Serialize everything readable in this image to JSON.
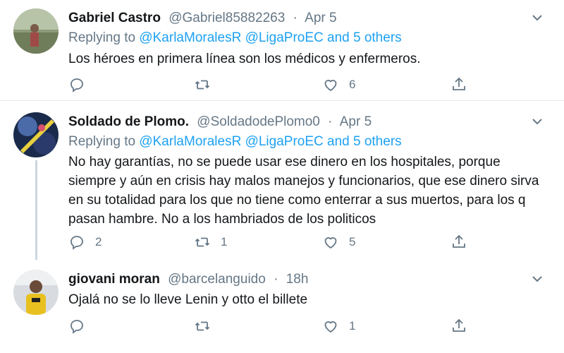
{
  "tweets": [
    {
      "name": "Gabriel Castro",
      "handle": "@Gabriel85882263",
      "dot": "·",
      "time": "Apr 5",
      "replying_prefix": "Replying to",
      "replying_mentions": "@KarlaMoralesR @LigaProEC and 5 others",
      "text": "Los héroes en primera línea son los médicos y enfermeros.",
      "reply_count": "",
      "retweet_count": "",
      "like_count": "6"
    },
    {
      "name": "Soldado de Plomo.",
      "handle": "@SoldadodePlomo0",
      "dot": "·",
      "time": "Apr 5",
      "replying_prefix": "Replying to",
      "replying_mentions": "@KarlaMoralesR @LigaProEC and 5 others",
      "text": "No hay garantías, no se puede usar ese dinero en los hospitales, porque siempre y aún en crisis hay malos manejos y funcionarios, que ese dinero sirva en su totalidad para los que no tiene como enterrar a sus muertos, para los q pasan hambre. No a los hambriados de los politicos",
      "reply_count": "2",
      "retweet_count": "1",
      "like_count": "5"
    },
    {
      "name": "giovani moran",
      "handle": "@barcelanguido",
      "dot": "·",
      "time": "18h",
      "text": "Ojalá no se lo lleve Lenin y otto el billete",
      "reply_count": "",
      "retweet_count": "",
      "like_count": "1"
    }
  ],
  "colors": {
    "mention": "#1da1f2",
    "muted": "#657786",
    "text": "#14171a",
    "divider": "#e6ecf0"
  },
  "icons": [
    "chevron-down-icon",
    "reply-icon",
    "retweet-icon",
    "like-icon",
    "share-icon"
  ]
}
